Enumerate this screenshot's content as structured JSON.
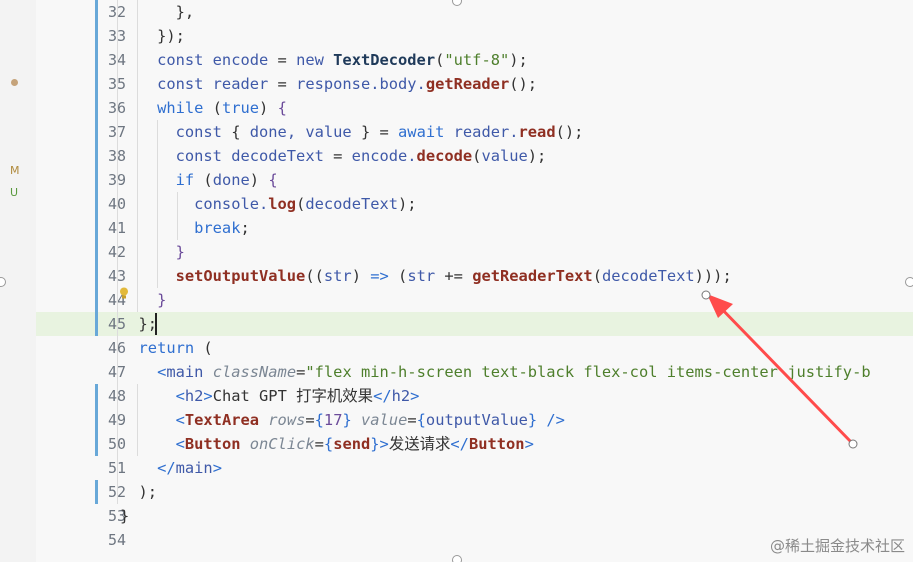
{
  "scm": {
    "modified_badge": "M",
    "untracked_badge": "U"
  },
  "lines": [
    {
      "n": "32",
      "segments": [
        [
          "pu",
          "      },"
        ]
      ]
    },
    {
      "n": "33",
      "segments": [
        [
          "pu",
          "    });"
        ]
      ]
    },
    {
      "n": "34",
      "segments": [
        [
          "pr",
          "    const encode "
        ],
        [
          "pu",
          "= "
        ],
        [
          "pr",
          "new "
        ],
        [
          "cls",
          "TextDecoder"
        ],
        [
          "pu",
          "("
        ],
        [
          "str",
          "\"utf-8\""
        ],
        [
          "pu",
          ");"
        ]
      ]
    },
    {
      "n": "35",
      "segments": [
        [
          "pr",
          "    const reader "
        ],
        [
          "pu",
          "= "
        ],
        [
          "pr",
          "response.body."
        ],
        [
          "fn",
          "getReader"
        ],
        [
          "pu",
          "();"
        ]
      ]
    },
    {
      "n": "36",
      "segments": [
        [
          "kw",
          "    while "
        ],
        [
          "pu",
          "("
        ],
        [
          "kw",
          "true"
        ],
        [
          "pu",
          ") "
        ],
        [
          "br",
          "{"
        ]
      ]
    },
    {
      "n": "37",
      "segments": [
        [
          "pr",
          "      const "
        ],
        [
          "pu",
          "{ "
        ],
        [
          "pr",
          "done, value "
        ],
        [
          "pu",
          "} = "
        ],
        [
          "kw",
          "await "
        ],
        [
          "pr",
          "reader."
        ],
        [
          "fn",
          "read"
        ],
        [
          "pu",
          "();"
        ]
      ]
    },
    {
      "n": "38",
      "segments": [
        [
          "pr",
          "      const decodeText "
        ],
        [
          "pu",
          "= "
        ],
        [
          "pr",
          "encode."
        ],
        [
          "fn",
          "decode"
        ],
        [
          "pu",
          "("
        ],
        [
          "pr",
          "value"
        ],
        [
          "pu",
          ");"
        ]
      ]
    },
    {
      "n": "39",
      "segments": [
        [
          "kw",
          "      if "
        ],
        [
          "pu",
          "("
        ],
        [
          "pr",
          "done"
        ],
        [
          "pu",
          ") "
        ],
        [
          "br",
          "{"
        ]
      ]
    },
    {
      "n": "40",
      "segments": [
        [
          "pr",
          "        console."
        ],
        [
          "fn",
          "log"
        ],
        [
          "pu",
          "("
        ],
        [
          "pr",
          "decodeText"
        ],
        [
          "pu",
          ");"
        ]
      ]
    },
    {
      "n": "41",
      "segments": [
        [
          "kw",
          "        break"
        ],
        [
          "pu",
          ";"
        ]
      ]
    },
    {
      "n": "42",
      "segments": [
        [
          "br",
          "      }"
        ]
      ]
    },
    {
      "n": "43",
      "segments": [
        [
          "fn",
          "      setOutputValue"
        ],
        [
          "pu",
          "(("
        ],
        [
          "pr",
          "str"
        ],
        [
          "pu",
          ") "
        ],
        [
          "op",
          "=> "
        ],
        [
          "pu",
          "("
        ],
        [
          "pr",
          "str "
        ],
        [
          "pu",
          "+= "
        ],
        [
          "fn",
          "getReaderText"
        ],
        [
          "pu",
          "("
        ],
        [
          "pr",
          "decodeText"
        ],
        [
          "pu",
          ")));"
        ]
      ]
    },
    {
      "n": "44",
      "segments": [
        [
          "br",
          "    }"
        ]
      ]
    },
    {
      "n": "45",
      "segments": [
        [
          "pu",
          "  };"
        ]
      ]
    },
    {
      "n": "46",
      "segments": [
        [
          "kw",
          "  return "
        ],
        [
          "pu",
          "("
        ]
      ]
    },
    {
      "n": "47",
      "segments": [
        [
          "tag",
          "    <"
        ],
        [
          "pr",
          "main "
        ],
        [
          "attr",
          "className"
        ],
        [
          "pu",
          "="
        ],
        [
          "str",
          "\"flex min-h-screen text-black flex-col items-center justify-b"
        ]
      ]
    },
    {
      "n": "48",
      "segments": [
        [
          "tag",
          "      <"
        ],
        [
          "pr",
          "h2"
        ],
        [
          "tag",
          ">"
        ],
        [
          "pu",
          "Chat GPT 打字机效果"
        ],
        [
          "tag",
          "</"
        ],
        [
          "pr",
          "h2"
        ],
        [
          "tag",
          ">"
        ]
      ]
    },
    {
      "n": "49",
      "segments": [
        [
          "tag",
          "      <"
        ],
        [
          "tagb",
          "TextArea "
        ],
        [
          "attr",
          "rows"
        ],
        [
          "pu",
          "="
        ],
        [
          "kw",
          "{"
        ],
        [
          "br",
          "17"
        ],
        [
          "kw",
          "} "
        ],
        [
          "attr",
          "value"
        ],
        [
          "pu",
          "="
        ],
        [
          "kw",
          "{"
        ],
        [
          "pr",
          "outputValue"
        ],
        [
          "kw",
          "} "
        ],
        [
          "tag",
          "/>"
        ]
      ]
    },
    {
      "n": "50",
      "segments": [
        [
          "tag",
          "      <"
        ],
        [
          "tagb",
          "Button "
        ],
        [
          "attr",
          "onClick"
        ],
        [
          "pu",
          "="
        ],
        [
          "kw",
          "{"
        ],
        [
          "fn",
          "send"
        ],
        [
          "kw",
          "}"
        ],
        [
          "tag",
          ">"
        ],
        [
          "pu",
          "发送请求"
        ],
        [
          "tag",
          "</"
        ],
        [
          "tagb",
          "Button"
        ],
        [
          "tag",
          ">"
        ]
      ]
    },
    {
      "n": "51",
      "segments": [
        [
          "tag",
          "    </"
        ],
        [
          "pr",
          "main"
        ],
        [
          "tag",
          ">"
        ]
      ]
    },
    {
      "n": "52",
      "segments": [
        [
          "pu",
          "  );"
        ]
      ]
    },
    {
      "n": "53",
      "segments": [
        [
          "pu",
          "}"
        ]
      ]
    },
    {
      "n": "54",
      "segments": [
        [
          "pu",
          ""
        ]
      ]
    }
  ],
  "highlighted_line": "45",
  "git_marked_lines": [
    "32",
    "33",
    "34",
    "35",
    "36",
    "37",
    "38",
    "39",
    "40",
    "41",
    "42",
    "43",
    "44",
    "45",
    "48",
    "49",
    "50",
    "52"
  ],
  "watermark": "@稀土掘金技术社区",
  "colors": {
    "annotation_arrow": "#ff4b4b",
    "git_bar": "#68a8d8",
    "highlight": "#e8f3e0"
  }
}
